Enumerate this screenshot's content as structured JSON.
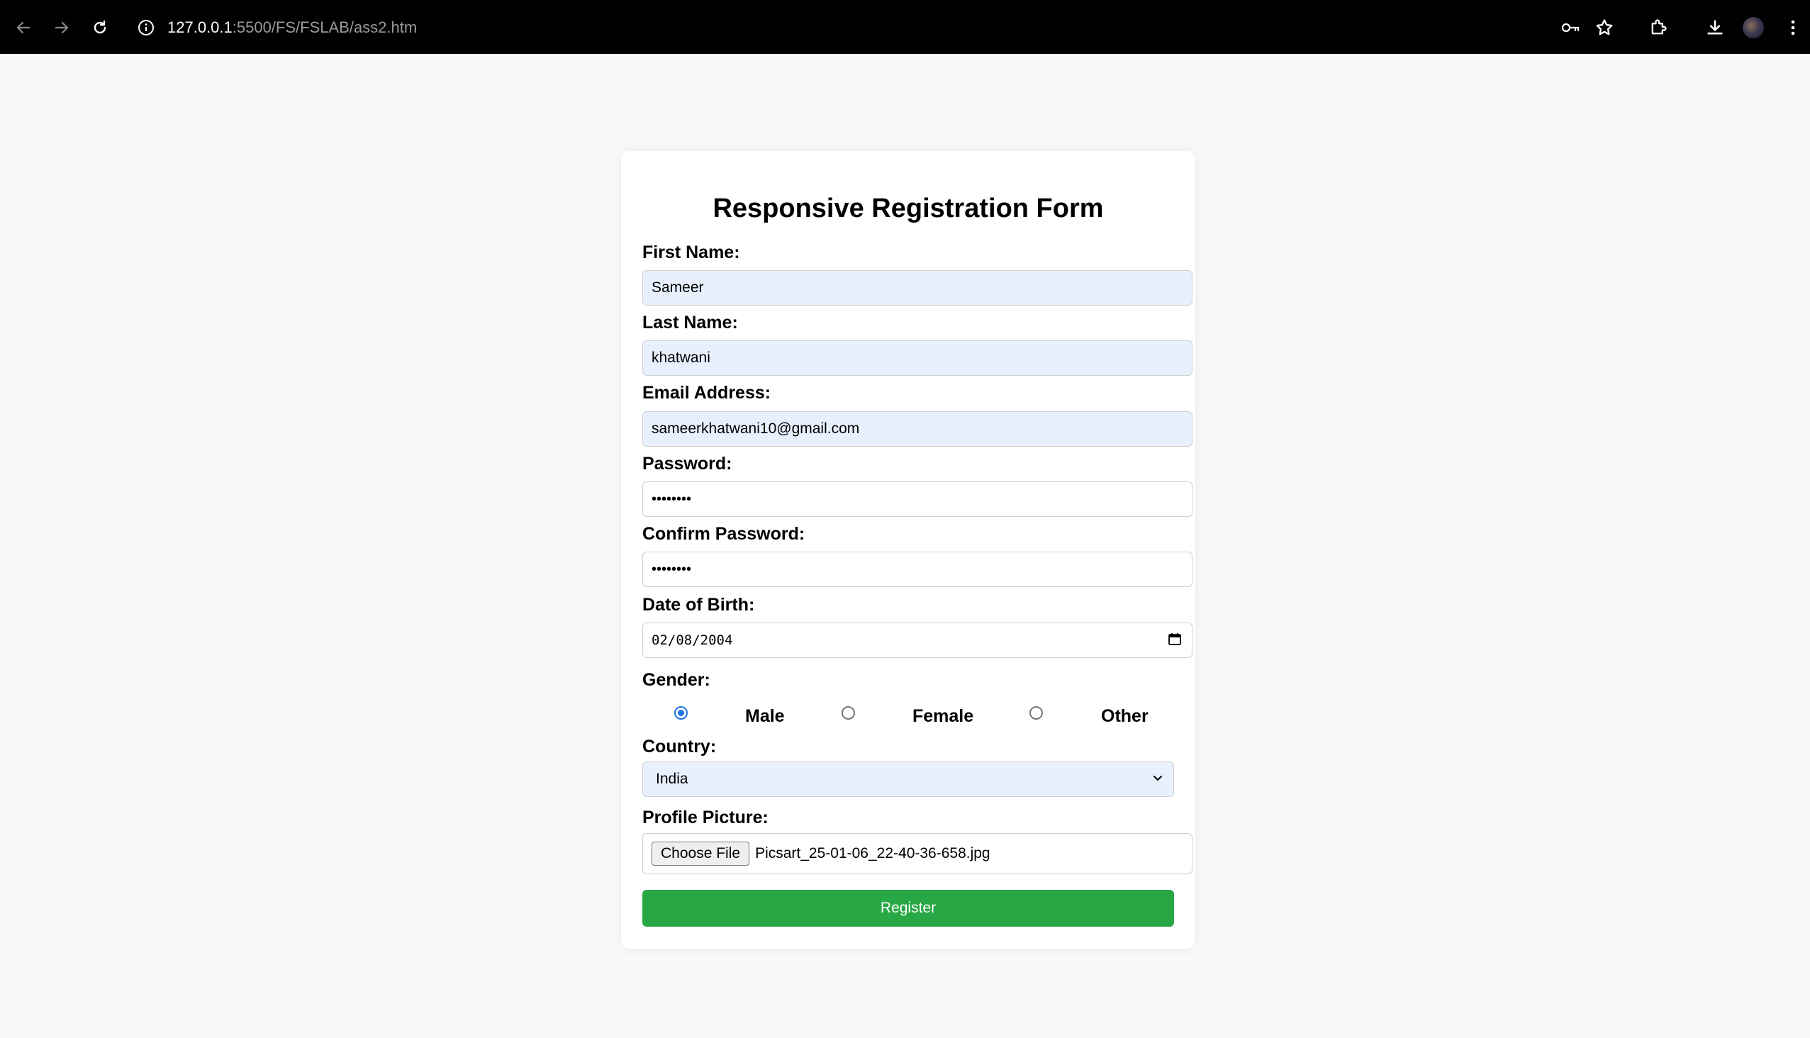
{
  "browser": {
    "url_host": "127.0.0.1",
    "url_path": ":5500/FS/FSLAB/ass2.htm"
  },
  "form": {
    "title": "Responsive Registration Form",
    "first_name": {
      "label": "First Name:",
      "value": "Sameer"
    },
    "last_name": {
      "label": "Last Name:",
      "value": "khatwani"
    },
    "email": {
      "label": "Email Address:",
      "value": "sameerkhatwani10@gmail.com"
    },
    "password": {
      "label": "Password:",
      "value": "••••••••"
    },
    "confirm_password": {
      "label": "Confirm Password:",
      "value": "••••••••"
    },
    "dob": {
      "label": "Date of Birth:",
      "value": "02/08/2004"
    },
    "gender": {
      "label": "Gender:",
      "options": [
        "Male",
        "Female",
        "Other"
      ],
      "selected": "Male"
    },
    "country": {
      "label": "Country:",
      "value": "India"
    },
    "profile_picture": {
      "label": "Profile Picture:",
      "button": "Choose File",
      "filename": "Picsart_25-01-06_22-40-36-658.jpg"
    },
    "submit_label": "Register"
  },
  "colors": {
    "autofill_bg": "#e8f0fe",
    "register_bg": "#28a745",
    "radio_accent": "#1a73e8"
  },
  "icons": [
    "back-arrow-icon",
    "forward-arrow-icon",
    "reload-icon",
    "info-icon",
    "key-icon",
    "star-icon",
    "extensions-icon",
    "download-icon",
    "profile-avatar-icon",
    "menu-dots-icon",
    "calendar-icon",
    "chevron-down-icon"
  ]
}
